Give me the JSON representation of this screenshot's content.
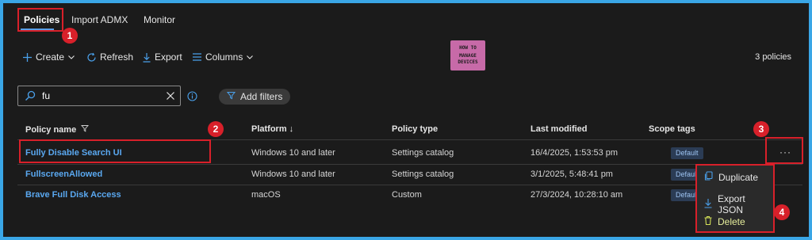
{
  "tabs": [
    {
      "label": "Policies",
      "active": true
    },
    {
      "label": "Import ADMX",
      "active": false
    },
    {
      "label": "Monitor",
      "active": false
    }
  ],
  "toolbar": {
    "create_label": "Create",
    "refresh_label": "Refresh",
    "export_label": "Export",
    "columns_label": "Columns",
    "policy_count": "3 policies"
  },
  "logo": {
    "line1": "HOW TO",
    "line2": "MANAGE",
    "line3": "DEVICES"
  },
  "search": {
    "value": "fu"
  },
  "filters": {
    "add_label": "Add filters"
  },
  "table": {
    "headers": {
      "name": "Policy name",
      "platform": "Platform ↓",
      "type": "Policy type",
      "modified": "Last modified",
      "scope": "Scope tags"
    },
    "rows": [
      {
        "name": "Fully Disable Search UI",
        "platform": "Windows 10 and later",
        "type": "Settings catalog",
        "modified": "16/4/2025, 1:53:53 pm",
        "scope": "Default"
      },
      {
        "name": "FullscreenAllowed",
        "platform": "Windows 10 and later",
        "type": "Settings catalog",
        "modified": "3/1/2025, 5:48:41 pm",
        "scope": "Default"
      },
      {
        "name": "Brave Full Disk Access",
        "platform": "macOS",
        "type": "Custom",
        "modified": "27/3/2024, 10:28:10 am",
        "scope": "Default"
      }
    ],
    "more_label": "···"
  },
  "context_menu": {
    "duplicate_label": "Duplicate",
    "export_json_label": "Export JSON",
    "delete_label": "Delete"
  },
  "callouts": [
    "1",
    "2",
    "3",
    "4"
  ],
  "colors": {
    "accent": "#5aa8f0",
    "callout_red": "#d8202a",
    "frame": "#3aa6e6",
    "background": "#1b1b1b",
    "badge_bg": "#2b3c55"
  }
}
